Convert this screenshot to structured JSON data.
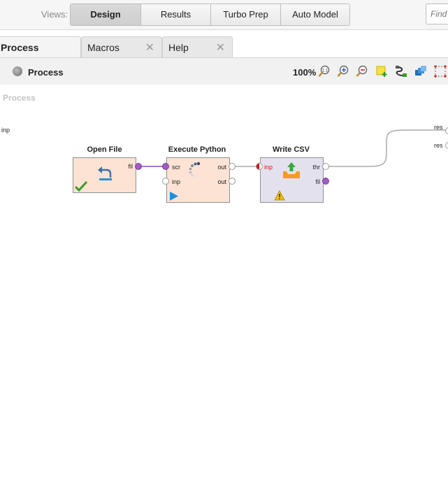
{
  "views": {
    "label": "Views:",
    "buttons": [
      {
        "label": "Design",
        "active": true
      },
      {
        "label": "Results",
        "active": false
      },
      {
        "label": "Turbo Prep",
        "active": false
      },
      {
        "label": "Auto Model",
        "active": false
      }
    ],
    "find_placeholder": "Find"
  },
  "tabs": [
    {
      "label": "Process",
      "active": true
    },
    {
      "label": "Macros",
      "close": "✕"
    },
    {
      "label": "Help",
      "close": "✕"
    }
  ],
  "toolbar": {
    "process_label": "Process",
    "zoom": "100%",
    "icons": [
      "zoom-fit-icon",
      "zoom-in-icon",
      "zoom-out-icon",
      "add-note-icon",
      "auto-wire-icon",
      "arrange-icon",
      "select-area-icon"
    ]
  },
  "canvas": {
    "title": "Process",
    "input_port": "inp",
    "result_ports": [
      "res",
      "res"
    ],
    "operators": {
      "open_file": {
        "title": "Open File",
        "ports_out": [
          "fil"
        ],
        "status": "ok"
      },
      "execute_python": {
        "title": "Execute Python",
        "ports_in": [
          "scr",
          "inp"
        ],
        "ports_out": [
          "out",
          "out"
        ]
      },
      "write_csv": {
        "title": "Write CSV",
        "ports_in": [
          "inp"
        ],
        "ports_out": [
          "thr",
          "fil"
        ],
        "status": "warning"
      }
    }
  },
  "colors": {
    "connection_purple": "#8b4aa8",
    "connection_gray": "#aaaaaa",
    "operator_orange": "#fde3d4",
    "operator_lavender": "#e4e1ef",
    "check_green": "#3a9a2a",
    "run_blue": "#1e8fd6",
    "warning_yellow": "#f2c200"
  }
}
